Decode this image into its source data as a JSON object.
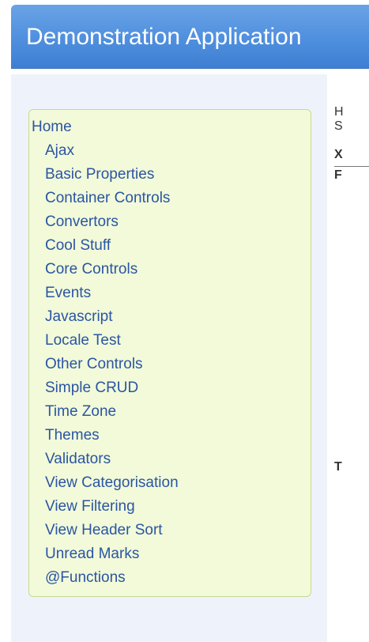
{
  "app": {
    "title": "Demonstration Application"
  },
  "nav": {
    "home": "Home",
    "items": [
      "Ajax",
      "Basic Properties",
      "Container Controls",
      "Convertors",
      "Cool Stuff",
      "Core Controls",
      "Events",
      "Javascript",
      "Locale Test",
      "Other Controls",
      "Simple CRUD",
      "Time Zone",
      "Themes",
      "Validators",
      "View Categorisation",
      "View Filtering",
      "View Header Sort",
      "Unread Marks",
      "@Functions"
    ]
  },
  "main": {
    "fragments": [
      "H",
      "S",
      "X",
      "F",
      "T"
    ]
  },
  "colors": {
    "banner": "#4f8fde",
    "nav_background": "#f2fad9",
    "nav_link": "#2a55a3"
  }
}
